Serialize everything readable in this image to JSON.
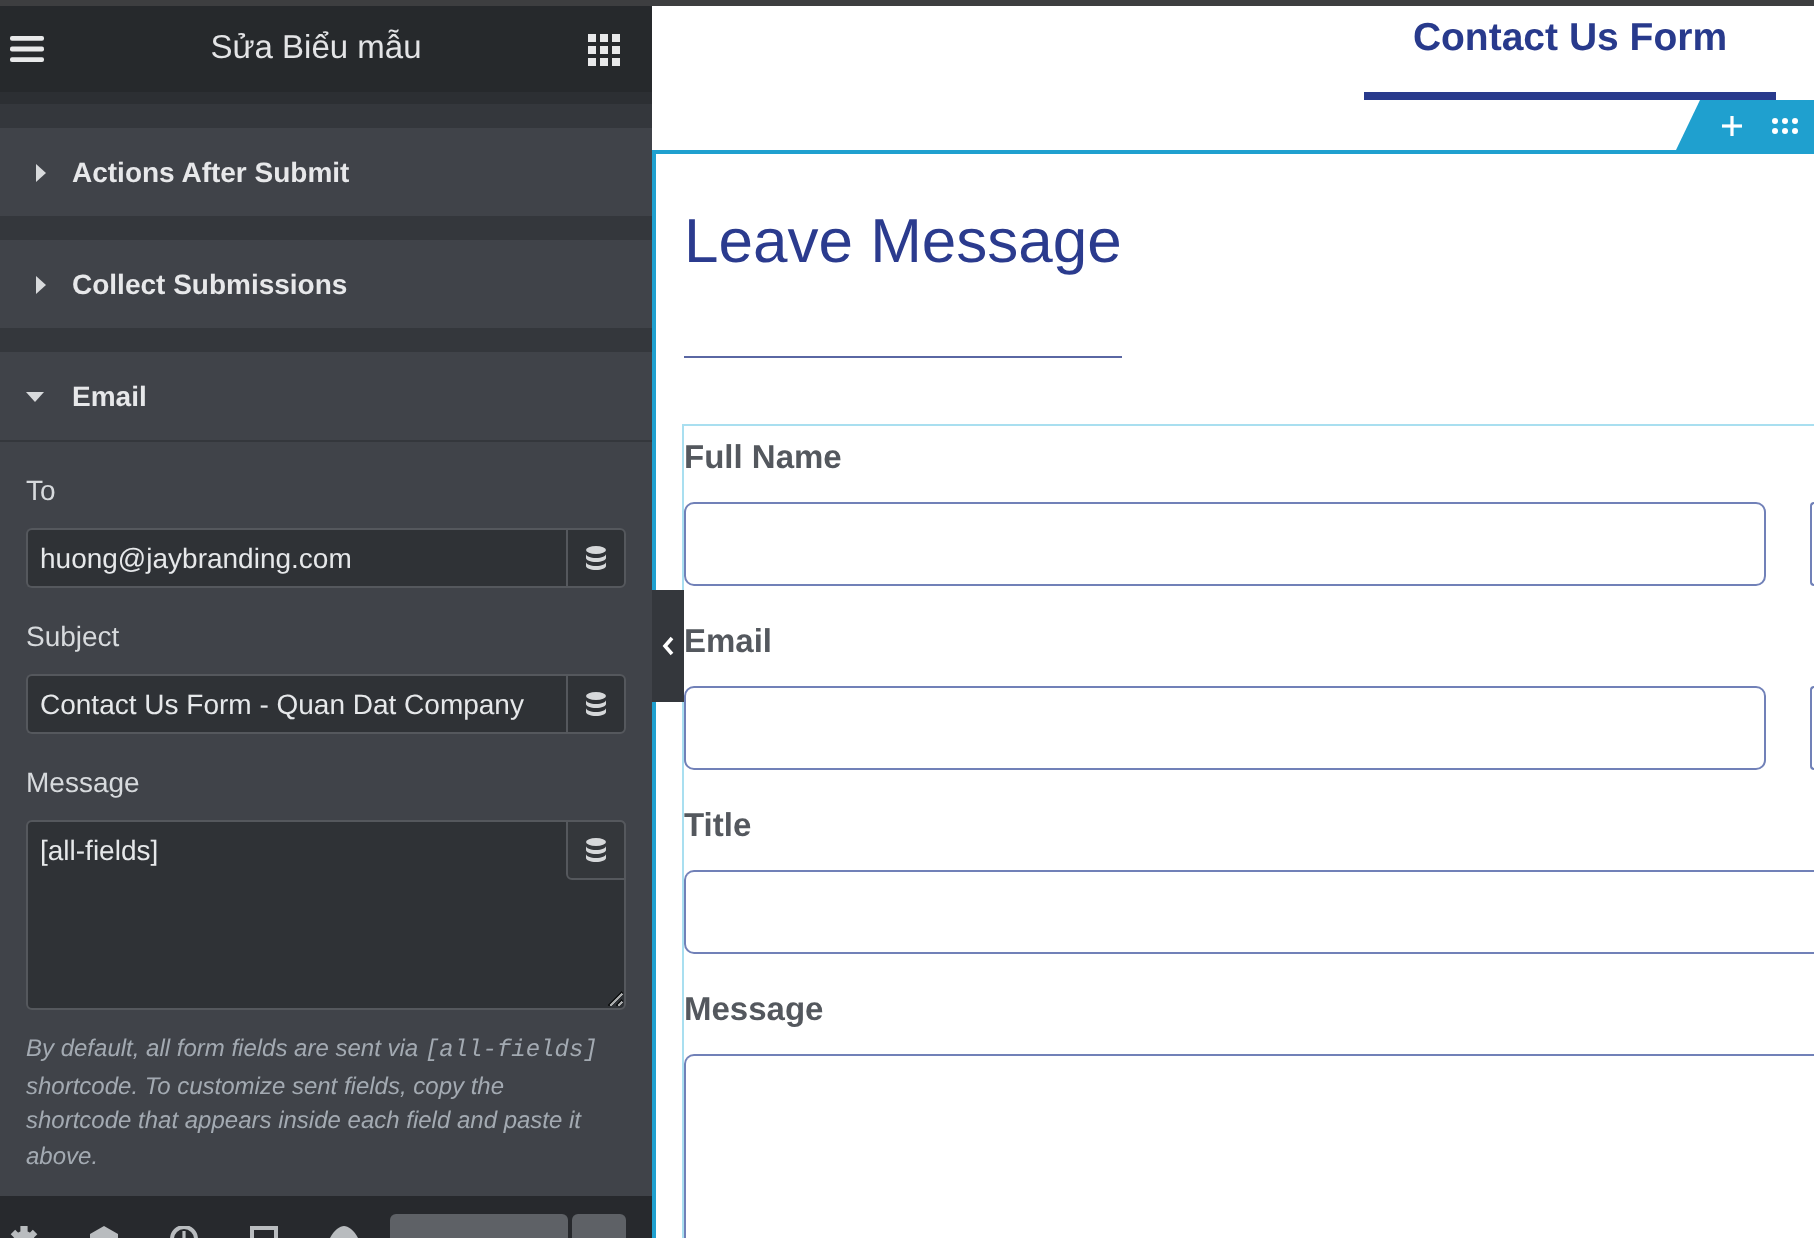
{
  "panel": {
    "title": "Sửa Biểu mẫu",
    "sections": [
      {
        "label": "Actions After Submit",
        "expanded": false
      },
      {
        "label": "Collect Submissions",
        "expanded": false
      },
      {
        "label": "Email",
        "expanded": true,
        "fields": [
          {
            "label": "To",
            "kind": "input",
            "value": "huong@jaybranding.com"
          },
          {
            "label": "Subject",
            "kind": "input",
            "value": "Contact Us Form - Quan Dat Company"
          },
          {
            "label": "Message",
            "kind": "textarea",
            "value": "[all-fields]"
          }
        ],
        "help_text": [
          {
            "kind": "plain",
            "text": "By default, all form fields are sent via "
          },
          {
            "kind": "code",
            "text": "[all-fields]"
          },
          {
            "kind": "plain",
            "text": " shortcode. To customize sent fields, copy the shortcode that appears inside each field and paste it above."
          }
        ]
      }
    ]
  },
  "preview": {
    "heading": "Contact Us Form",
    "form_title": "Leave Message",
    "fields": [
      {
        "label": "Full Name",
        "kind": "input",
        "full_width": false
      },
      {
        "kind": "input",
        "full_width": false
      },
      {
        "label": "Email",
        "kind": "input",
        "full_width": false
      },
      {
        "kind": "input",
        "full_width": false
      },
      {
        "label": "Title",
        "kind": "input",
        "full_width": true
      },
      {
        "label": "Message",
        "kind": "textarea",
        "full_width": true
      }
    ]
  }
}
